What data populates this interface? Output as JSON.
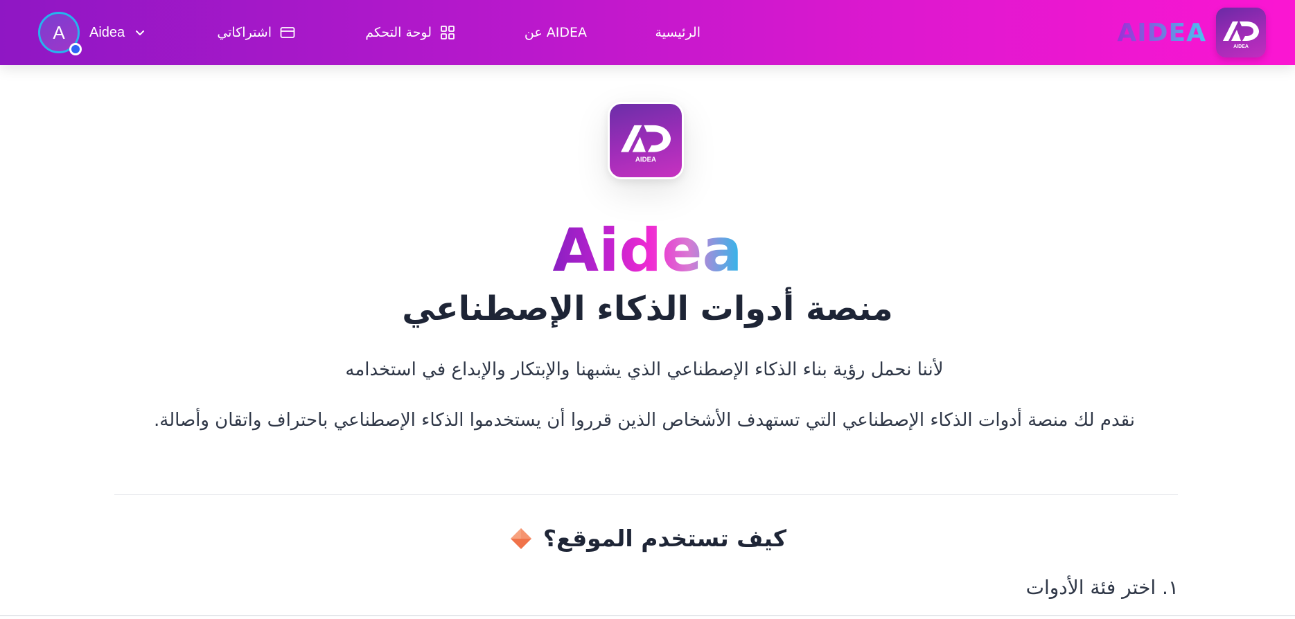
{
  "navbar": {
    "brand_text": "AIDEA",
    "links": {
      "home": "الرئيسية",
      "about": "عن AIDEA",
      "dashboard": "لوحة التحكم",
      "subscriptions": "اشتراكاتي"
    },
    "user": {
      "avatar_letter": "A",
      "name": "Aidea"
    },
    "icons": {
      "dashboard": "grid-icon",
      "subscriptions": "credit-card-icon",
      "user_menu": "chevron-down-icon"
    }
  },
  "logo": {
    "caption": "AIDEA"
  },
  "hero": {
    "title": "Aidea",
    "subtitle": "منصة أدوات الذكاء الإصطناعي",
    "description_1": "لأننا نحمل رؤية بناء الذكاء الإصطناعي الذي يشبهنا والإبتكار والإبداع في استخدامه",
    "description_2": "نقدم لك منصة أدوات الذكاء الإصطناعي التي تستهدف الأشخاص الذين قرروا أن يستخدموا الذكاء الإصطناعي باحتراف واتقان وأصالة."
  },
  "how_to": {
    "title": "كيف تستخدم الموقع؟",
    "icon": "orange-diamond-icon",
    "step_1": "١. اختر فئة الأدوات"
  },
  "colors": {
    "nav_gradient_start": "#8f17c4",
    "nav_gradient_end": "#fb16d2",
    "avatar_ring": "#27b3ee",
    "status_dot": "#2e63f6",
    "diamond": "#f0734a"
  }
}
